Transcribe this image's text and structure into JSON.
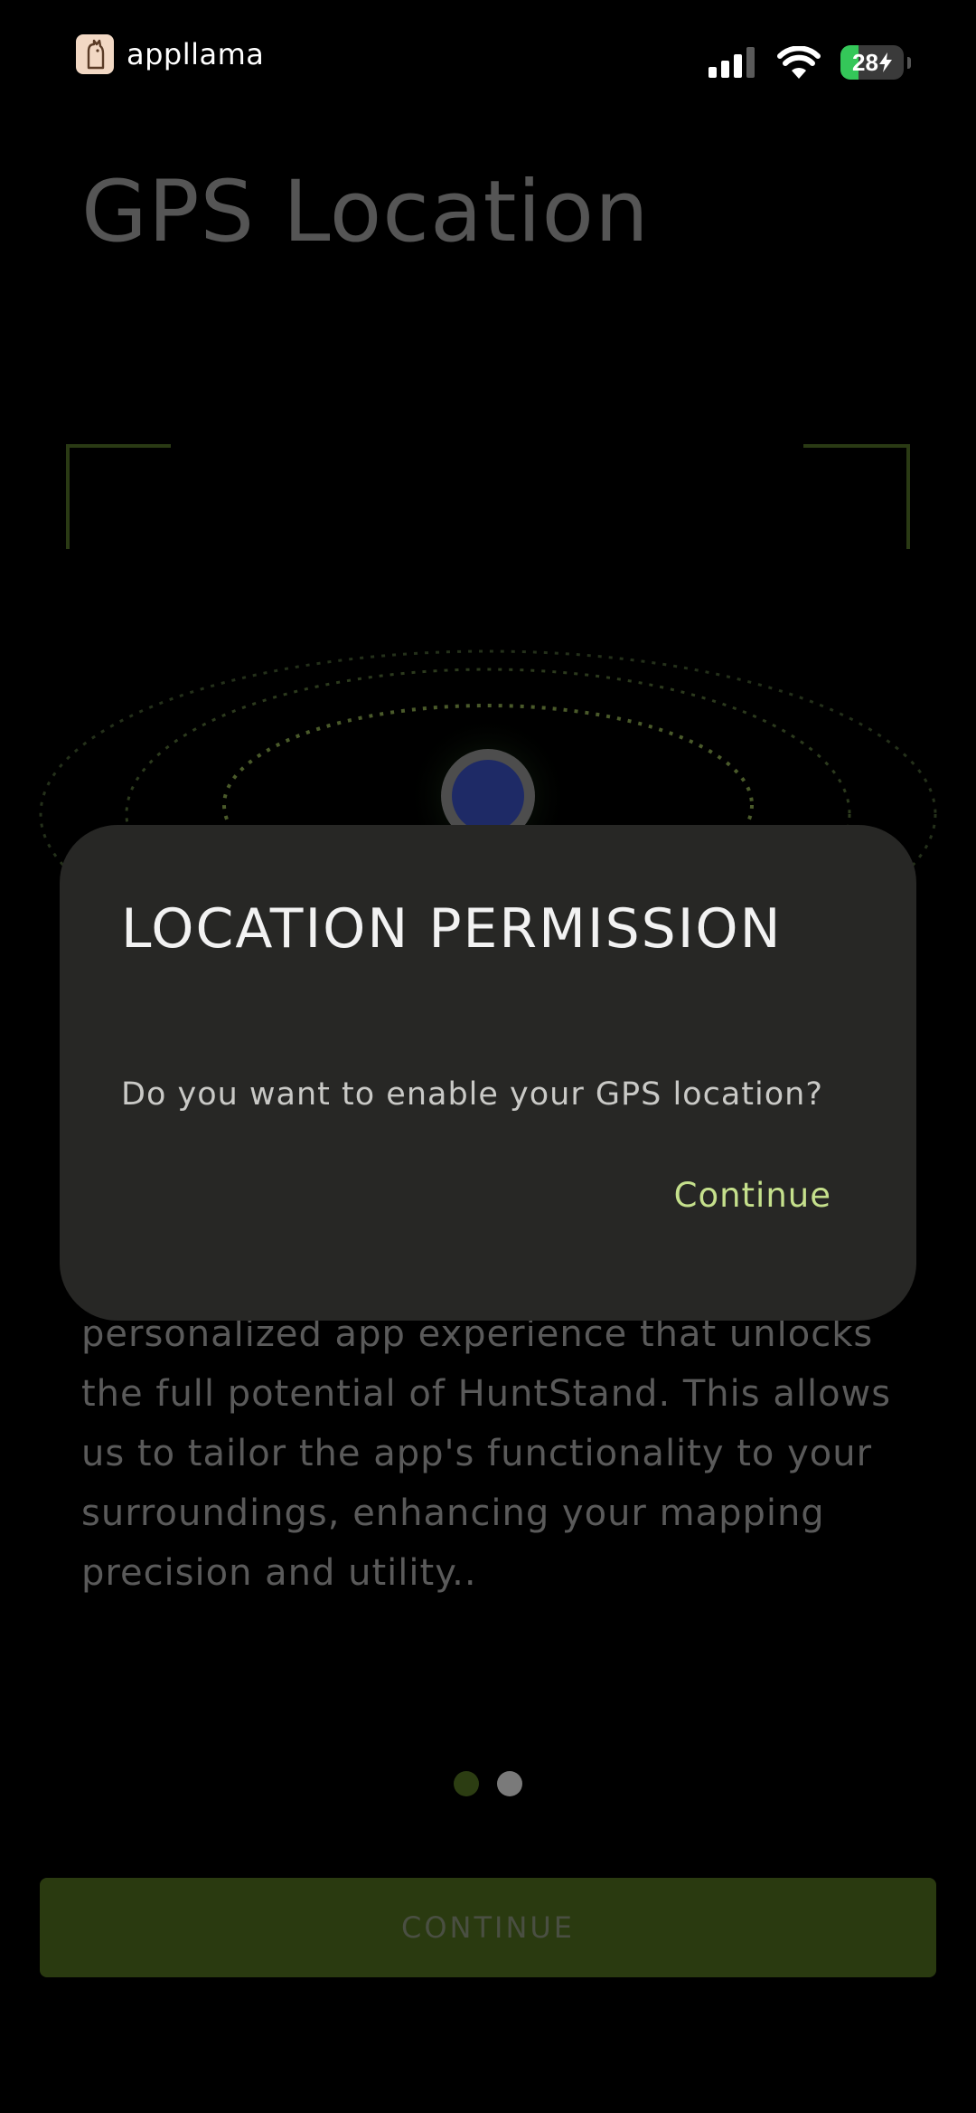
{
  "status_bar": {
    "brand_name": "appllama",
    "battery_level": "28",
    "battery_fraction": 0.28,
    "battery_color": "#34c759"
  },
  "page": {
    "title": "GPS Location",
    "description": "personalized app experience that unlocks the full potential of HuntStand. This allows us to tailor the app's functionality to your surroundings, enhancing your mapping precision and utility..",
    "continue_label": "CONTINUE",
    "pager": {
      "total": 2,
      "current": 1
    },
    "accent_color": "#2a3a10"
  },
  "dialog": {
    "title": "LOCATION PERMISSION",
    "message": "Do you want to enable your GPS location?",
    "action_label": "Continue",
    "action_color": "#c5e08c"
  },
  "icons": {
    "brand": "llama-logo-icon",
    "signal": "cellular-signal-icon",
    "wifi": "wifi-icon",
    "battery": "battery-charging-icon",
    "location": "location-dot-icon"
  }
}
